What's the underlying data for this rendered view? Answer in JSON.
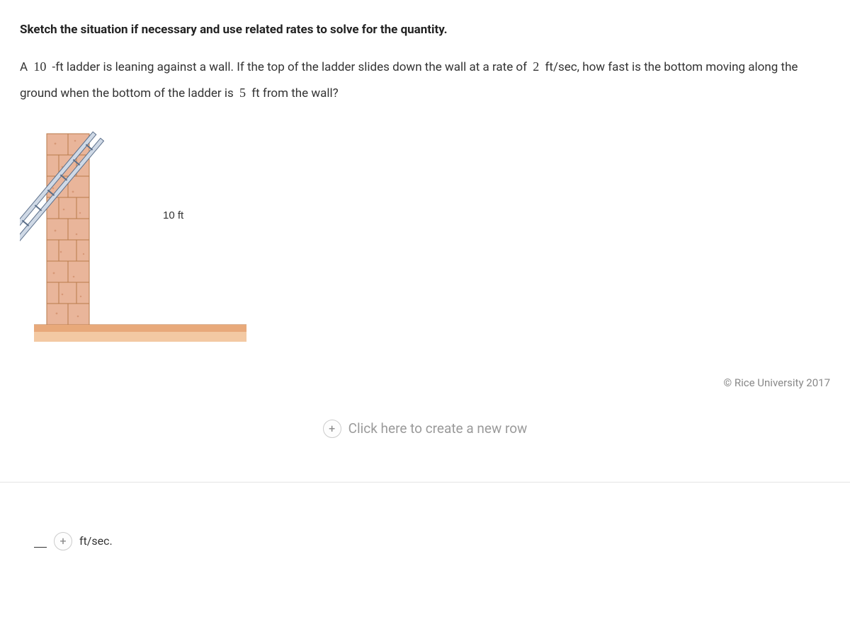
{
  "instruction": "Sketch the situation if necessary and use related rates to solve for the quantity.",
  "problem": {
    "prefixA": "A",
    "ladderLen": "10",
    "seg1": "-ft ladder is leaning against a wall. If the top of the ladder slides down the wall at a rate of",
    "rate": "2",
    "seg2": "ft/sec, how fast is the bottom moving along the ground when the bottom of the ladder is",
    "dist": "5",
    "seg3": "ft from the wall?"
  },
  "diagram": {
    "ladderLabel": "10 ft"
  },
  "attribution": "© Rice University 2017",
  "newRowLabel": "Click here to create a new row",
  "answer": {
    "unit": "ft/sec."
  }
}
